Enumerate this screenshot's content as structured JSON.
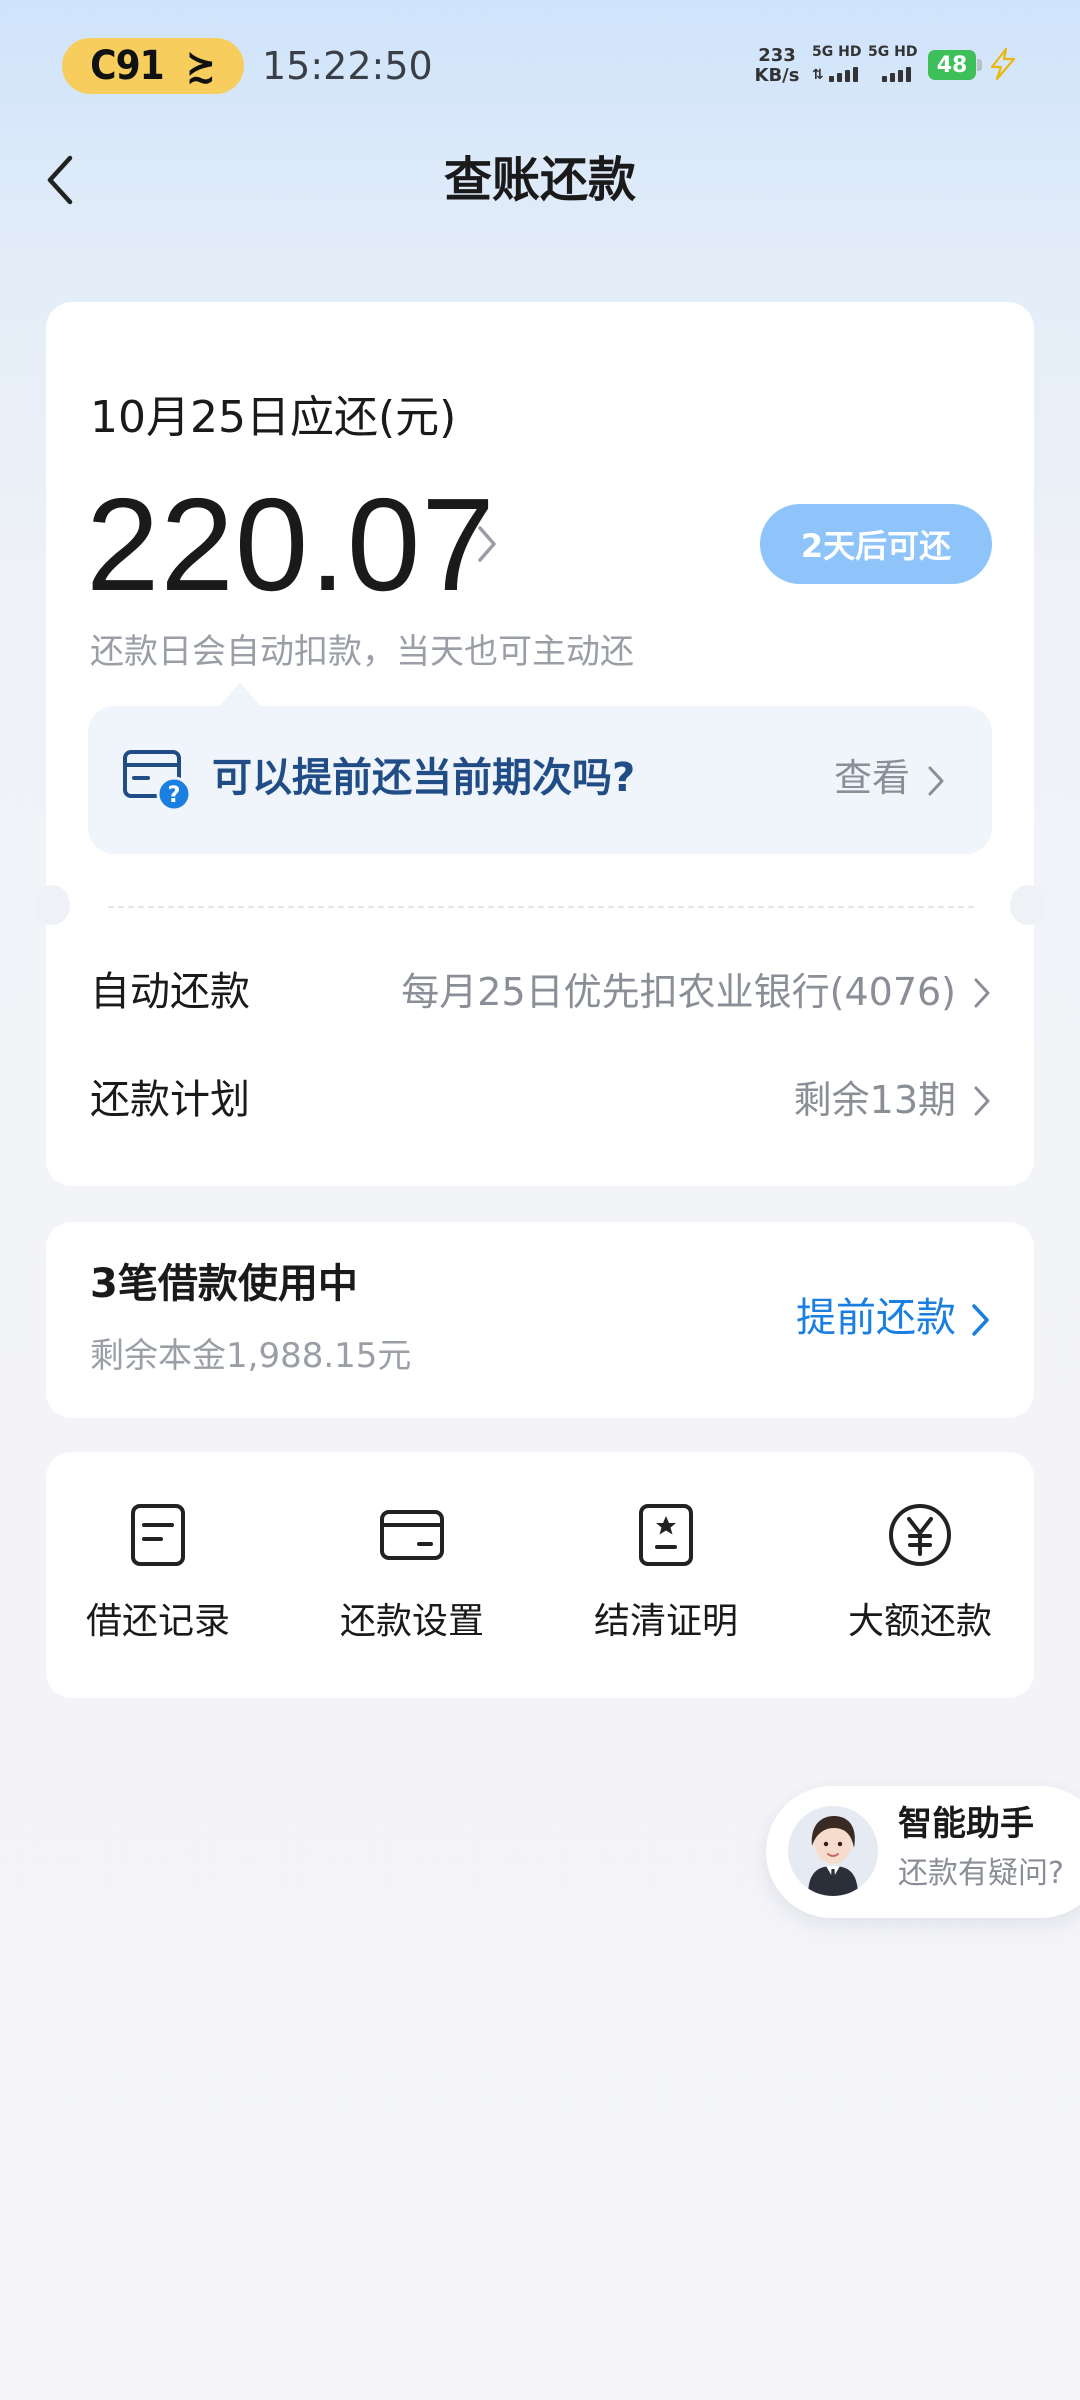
{
  "status_bar": {
    "train_code": "C91",
    "gate_symbol": "≿",
    "time": "15:22:50",
    "net_speed_value": "233",
    "net_speed_unit": "KB/s",
    "sim1_label": "5G HD",
    "sim2_label": "5G HD",
    "battery": "48"
  },
  "header": {
    "title": "查账还款"
  },
  "bill": {
    "due_label": "10月25日应还(元)",
    "amount": "220.07",
    "repay_button": "2天后可还",
    "auto_deduct_hint": "还款日会自动扣款，当天也可主动还",
    "faq_question": "可以提前还当前期次吗?",
    "faq_link": "查看"
  },
  "settings": {
    "auto_repay_label": "自动还款",
    "auto_repay_value": "每月25日优先扣农业银行(4076)",
    "plan_label": "还款计划",
    "plan_value": "剩余13期"
  },
  "loan": {
    "title": "3笔借款使用中",
    "remaining": "剩余本金1,988.15元",
    "prepay_link": "提前还款"
  },
  "tools": [
    {
      "label": "借还记录",
      "icon": "record-icon"
    },
    {
      "label": "还款设置",
      "icon": "card-icon"
    },
    {
      "label": "结清证明",
      "icon": "certificate-icon"
    },
    {
      "label": "大额还款",
      "icon": "yuan-icon"
    }
  ],
  "assistant": {
    "title": "智能助手",
    "subtitle": "还款有疑问?"
  },
  "colors": {
    "accent_blue": "#1a7fe0",
    "pill_blue": "#8fc4fb",
    "faq_text": "#214d86",
    "train_pill": "#f7ce5d",
    "battery": "#3dbf5a"
  }
}
